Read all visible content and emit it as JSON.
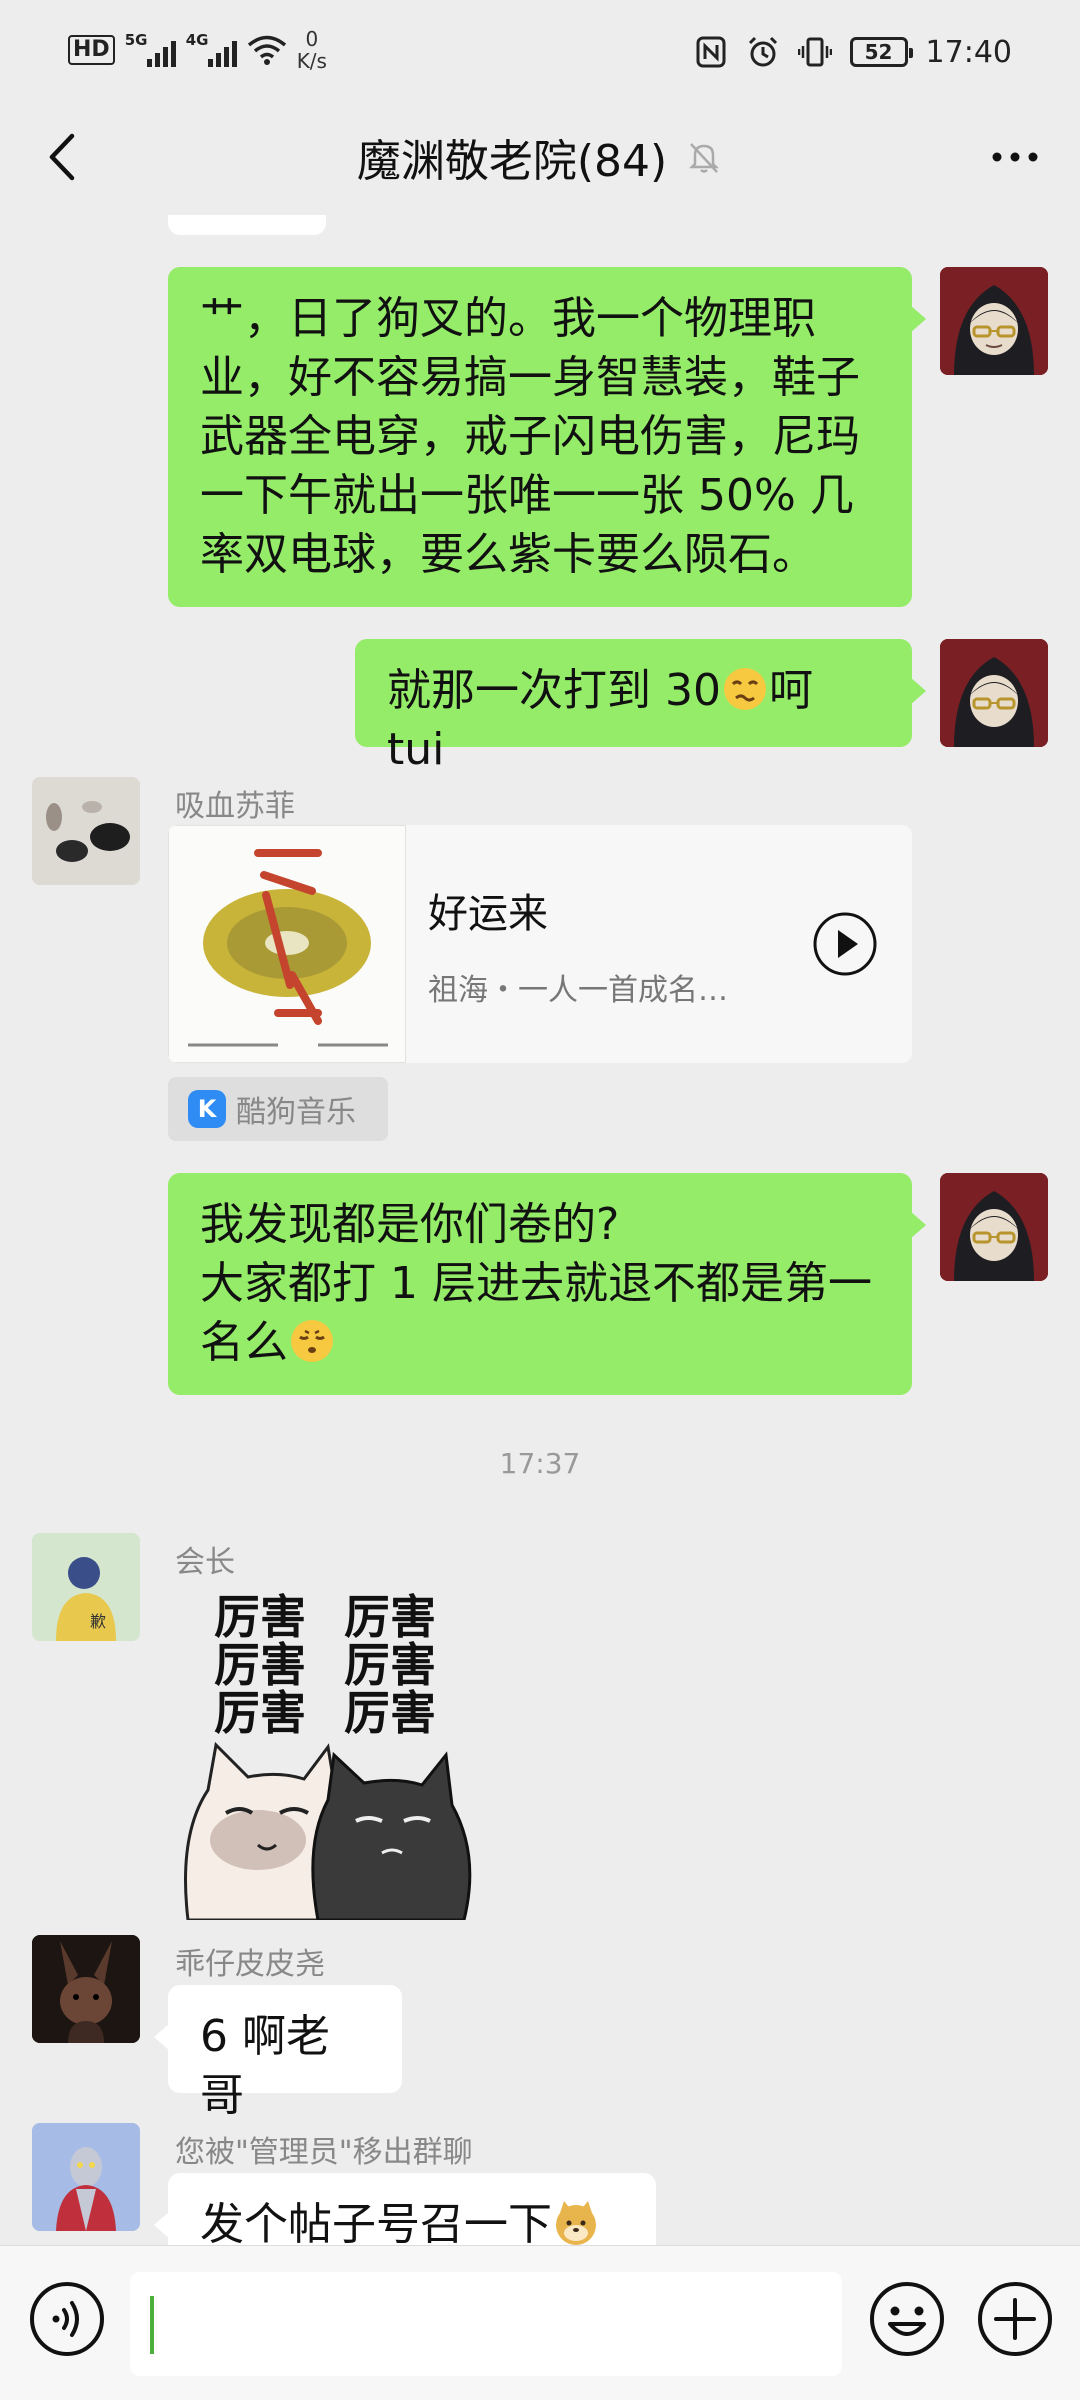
{
  "status_bar": {
    "hd": "HD",
    "sim1": "5G",
    "sim2": "4G",
    "net_speed_value": "0",
    "net_speed_unit": "K/s",
    "battery": "52",
    "time": "17:40"
  },
  "header": {
    "title": "魔渊敬老院(84)"
  },
  "messages": {
    "m1": {
      "line1": "艹，日了狗叉的。我一个物理职",
      "line2": "业，好不容易搞一身智慧装，鞋子",
      "line3": "武器全电穿，戒子闪电伤害，尼玛",
      "line4": "一下午就出一张唯一一张 50% 几",
      "line5": "率双电球，要么紫卡要么陨石。"
    },
    "m2": {
      "before": "就那一次打到 30",
      "after": "呵 tui"
    },
    "m3": {
      "sender": "吸血苏菲",
      "music_title": "好运来",
      "music_artist": "祖海・一人一首成名…",
      "source": "酷狗音乐"
    },
    "m4": {
      "line1": "我发现都是你们卷的?",
      "line2": "大家都打 1 层进去就退不都是第一",
      "line3": "名么"
    },
    "timestamp": "17:37",
    "m5": {
      "sender": "会长",
      "sticker_text": "厉害"
    },
    "m6": {
      "sender": "乖仔皮皮尧",
      "text": "6 啊老哥"
    },
    "m7": {
      "sender": "您被\"管理员\"移出群聊",
      "text": "发个帖子号召一下"
    }
  },
  "input": {
    "value": ""
  },
  "colors": {
    "self_bubble": "#95ec69",
    "other_bubble": "#ffffff",
    "background": "#ededed",
    "caret": "#4cb03a"
  },
  "icons": [
    "back-icon",
    "mute-icon",
    "more-icon",
    "play-icon",
    "voice-icon",
    "emoji-icon",
    "plus-icon"
  ]
}
